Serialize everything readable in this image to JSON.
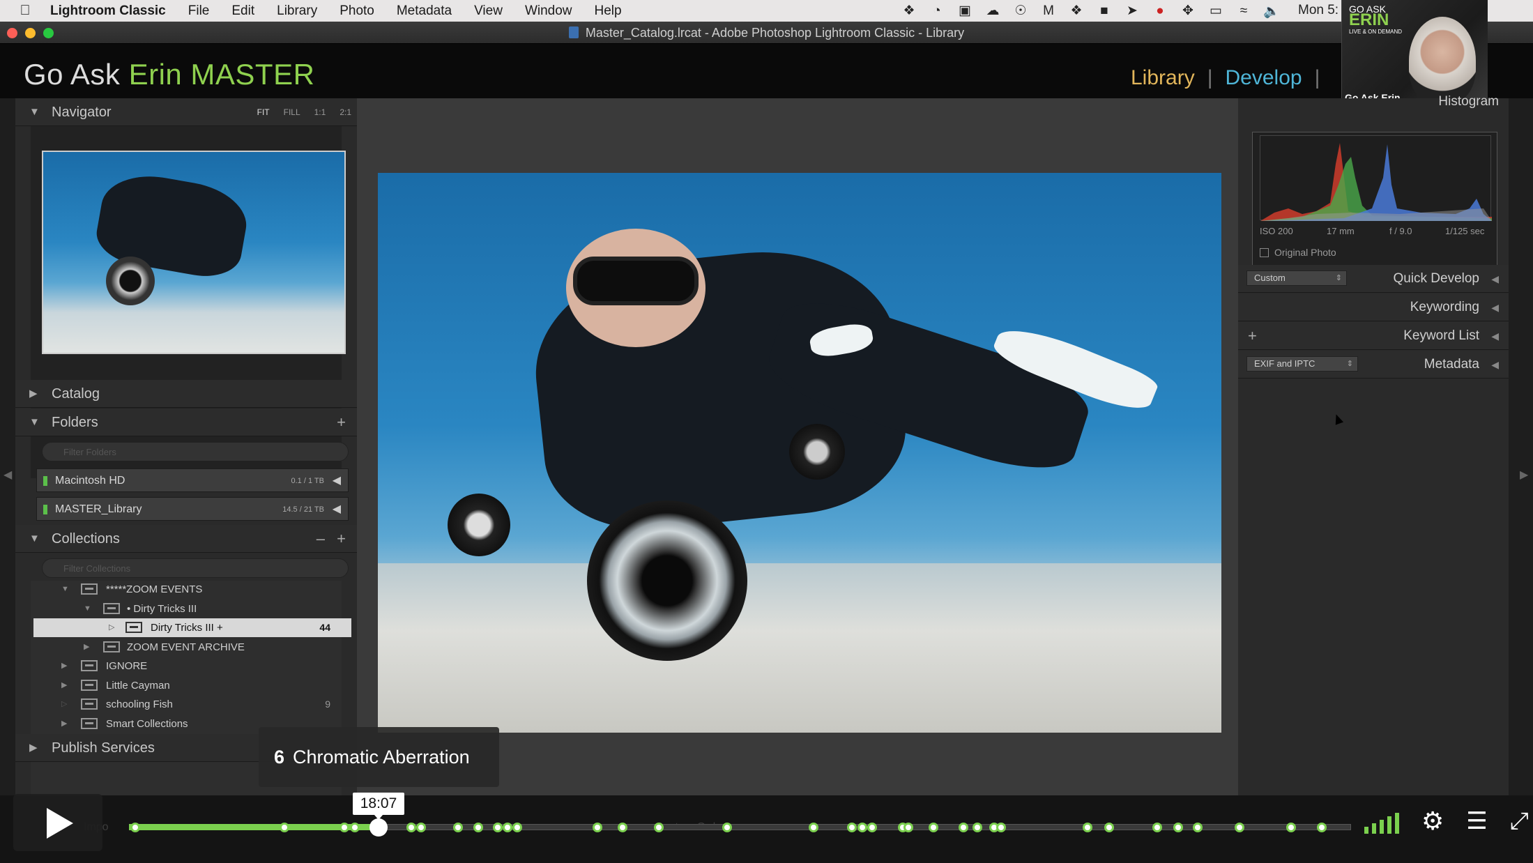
{
  "menubar": {
    "app": "Lightroom Classic",
    "items": [
      "File",
      "Edit",
      "Library",
      "Photo",
      "Metadata",
      "View",
      "Window",
      "Help"
    ],
    "clock": "Mon 5:"
  },
  "window": {
    "title": "Master_Catalog.lrcat - Adobe Photoshop Lightroom Classic - Library"
  },
  "identity": {
    "prefix": "Go Ask ",
    "name": "Erin MASTER"
  },
  "modules": {
    "library": "Library",
    "separator": "|",
    "develop": "Develop"
  },
  "webcam": {
    "logo_top": "GO ASK",
    "logo_main": "ERIN",
    "logo_sub": "LIVE & ON DEMAND",
    "name_tag": "Go Ask Erin"
  },
  "left": {
    "navigator": {
      "title": "Navigator",
      "zoom": [
        "FIT",
        "FILL",
        "1:1",
        "2:1"
      ]
    },
    "catalog": {
      "title": "Catalog"
    },
    "folders": {
      "title": "Folders",
      "filter_placeholder": "Filter Folders",
      "volumes": [
        {
          "name": "Macintosh HD",
          "capacity": "0.1 / 1 TB"
        },
        {
          "name": "MASTER_Library",
          "capacity": "14.5 / 21 TB"
        }
      ]
    },
    "collections": {
      "title": "Collections",
      "filter_placeholder": "Filter Collections",
      "items": [
        {
          "label": "*****ZOOM EVENTS",
          "count": ""
        },
        {
          "label": "• Dirty Tricks III",
          "count": ""
        },
        {
          "label": "Dirty Tricks III +",
          "count": "44"
        },
        {
          "label": "ZOOM EVENT ARCHIVE",
          "count": ""
        },
        {
          "label": "IGNORE",
          "count": ""
        },
        {
          "label": "Little Cayman",
          "count": ""
        },
        {
          "label": "schooling Fish",
          "count": "9"
        },
        {
          "label": "Smart Collections",
          "count": ""
        }
      ]
    },
    "publish": {
      "title": "Publish Services"
    }
  },
  "right": {
    "histogram": {
      "title": "Histogram",
      "iso": "ISO 200",
      "focal": "17 mm",
      "aperture": "f / 9.0",
      "shutter": "1/125 sec",
      "original_photo": "Original Photo"
    },
    "quick_develop": {
      "title": "Quick Develop",
      "preset": "Custom"
    },
    "keywording": {
      "title": "Keywording"
    },
    "keyword_list": {
      "title": "Keyword List"
    },
    "metadata": {
      "title": "Metadata",
      "preset": "EXIF and IPTC"
    }
  },
  "video": {
    "chapter_number": "6",
    "chapter_title": "Chromatic Aberration",
    "current_time": "18:07",
    "progress_fraction": 0.204,
    "ghost_toolbar": "Impo",
    "ghost_sort": "Custom Order",
    "colors": {
      "accent": "#7bd04e"
    }
  }
}
